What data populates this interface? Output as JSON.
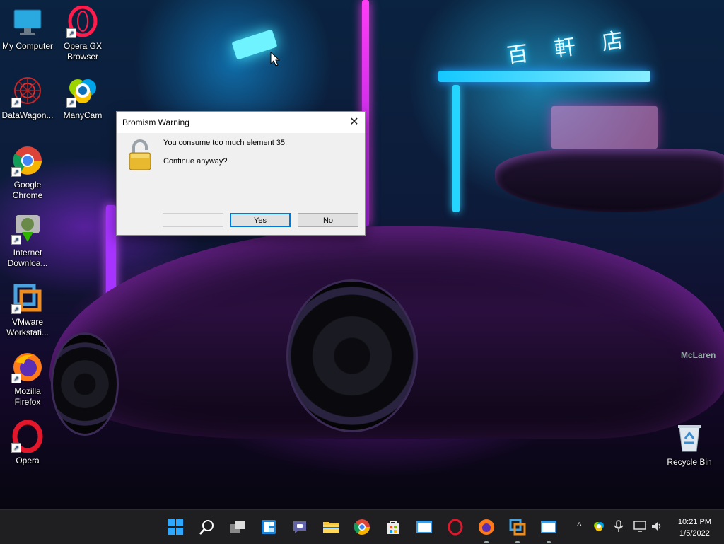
{
  "desktop": {
    "icons": [
      {
        "label": "My Computer",
        "icon": "computer-icon"
      },
      {
        "label": "Opera GX\nBrowser",
        "icon": "opera-gx-icon"
      },
      {
        "label": "DataWagon...",
        "icon": "datawagon-icon"
      },
      {
        "label": "ManyCam",
        "icon": "manycam-icon"
      },
      {
        "label": "Google\nChrome",
        "icon": "chrome-icon"
      },
      {
        "label": "Internet\nDownloa...",
        "icon": "idm-icon"
      },
      {
        "label": "VMware\nWorkstati...",
        "icon": "vmware-icon"
      },
      {
        "label": "Mozilla\nFirefox",
        "icon": "firefox-icon"
      },
      {
        "label": "Opera",
        "icon": "opera-icon"
      },
      {
        "label": "Recycle Bin",
        "icon": "recycle-bin-icon"
      }
    ],
    "wallpaper_sign": "百 軒 店",
    "car_badge": "McLaren"
  },
  "dialog": {
    "title": "Bromism Warning",
    "message_line1": "You consume too much element 35.",
    "message_line2": "Continue anyway?",
    "close_glyph": "✕",
    "buttons": {
      "blank": "",
      "yes": "Yes",
      "no": "No"
    }
  },
  "taskbar": {
    "apps": [
      "start",
      "search",
      "task-view",
      "widgets",
      "teams-chat",
      "file-explorer",
      "chrome",
      "store",
      "app-window",
      "opera",
      "firefox",
      "vmware",
      "app-window-2"
    ],
    "tray_chevron": "^",
    "clock_time": "10:21 PM",
    "clock_date": "1/5/2022"
  },
  "colors": {
    "accent": "#0078d7",
    "taskbar": "#1f1f22",
    "dialog_bg": "#f0f0f0"
  }
}
